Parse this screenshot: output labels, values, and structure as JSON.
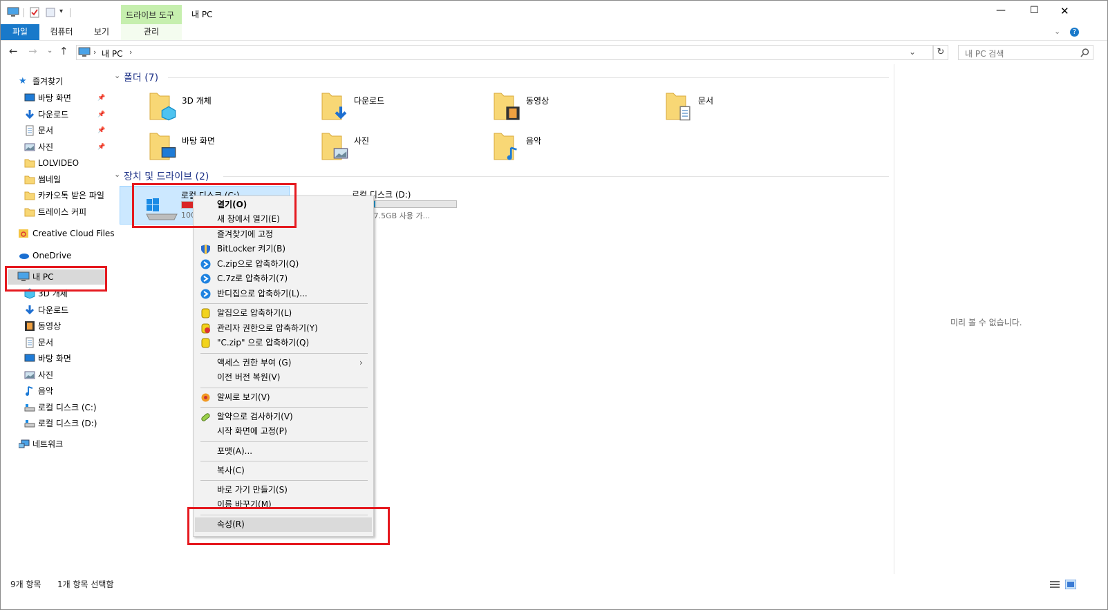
{
  "titlebar": {
    "title": "내 PC",
    "context_tab": "드라이브 도구",
    "minimize": "—",
    "maximize": "☐",
    "close": "✕"
  },
  "ribbon": {
    "tabs": [
      "파일",
      "컴퓨터",
      "보기",
      "관리"
    ]
  },
  "address": {
    "path_root": "내 PC",
    "sep": "›",
    "search_placeholder": "내 PC 검색"
  },
  "nav": {
    "quick_access": "즐겨찾기",
    "quick_items": [
      {
        "label": "바탕 화면",
        "icon": "desktop-icon"
      },
      {
        "label": "다운로드",
        "icon": "download-icon"
      },
      {
        "label": "문서",
        "icon": "document-icon"
      },
      {
        "label": "사진",
        "icon": "picture-icon"
      },
      {
        "label": "LOLVIDEO",
        "icon": "folder-icon"
      },
      {
        "label": "썸네일",
        "icon": "folder-icon"
      },
      {
        "label": "카카오톡 받은 파일",
        "icon": "folder-icon"
      },
      {
        "label": "트레이스 커피",
        "icon": "folder-icon"
      }
    ],
    "creative_cloud": "Creative Cloud Files",
    "onedrive": "OneDrive",
    "this_pc": "내 PC",
    "pc_items": [
      {
        "label": "3D 개체",
        "icon": "cube-icon"
      },
      {
        "label": "다운로드",
        "icon": "download-icon"
      },
      {
        "label": "동영상",
        "icon": "video-icon"
      },
      {
        "label": "문서",
        "icon": "document-icon"
      },
      {
        "label": "바탕 화면",
        "icon": "desktop-icon"
      },
      {
        "label": "사진",
        "icon": "picture-icon"
      },
      {
        "label": "음악",
        "icon": "music-icon"
      },
      {
        "label": "로컬 디스크 (C:)",
        "icon": "drive-icon"
      },
      {
        "label": "로컬 디스크 (D:)",
        "icon": "drive-icon"
      }
    ],
    "network": "네트워크"
  },
  "content": {
    "folders_header": "폴더 (7)",
    "folders": [
      "3D 개체",
      "다운로드",
      "동영상",
      "문서",
      "바탕 화면",
      "사진",
      "음악"
    ],
    "drives_header": "장치 및 드라이브 (2)",
    "drive_c": {
      "name": "로컬 디스크 (C:)",
      "free": "100",
      "used_fraction": 0.97,
      "bar_color": "#da2626"
    },
    "drive_d": {
      "name": "로컬 디스크 (D:)",
      "free": "B 중 57.5GB 사용 가...",
      "used_fraction": 0.22,
      "bar_color": "#26a0da"
    },
    "preview": "미리 볼 수 없습니다."
  },
  "context_menu": [
    {
      "label": "열기(O)",
      "bold": true
    },
    {
      "label": "새 창에서 열기(E)"
    },
    {
      "label": "즐겨찾기에 고정"
    },
    {
      "label": "BitLocker 켜기(B)",
      "icon": "shield-icon"
    },
    {
      "label": "C.zip으로 압축하기(Q)",
      "icon": "bandizip-icon"
    },
    {
      "label": "C.7z로 압축하기(7)",
      "icon": "bandizip-icon"
    },
    {
      "label": "반디집으로 압축하기(L)...",
      "icon": "bandizip-icon"
    },
    {
      "label": "알집으로 압축하기(L)",
      "icon": "alzip-icon"
    },
    {
      "label": "관리자 권한으로 압축하기(Y)",
      "icon": "alzip-admin-icon"
    },
    {
      "label": "\"C.zip\" 으로 압축하기(Q)",
      "icon": "alzip-icon"
    },
    {
      "label": "액세스 권한 부여 (G)",
      "submenu": true
    },
    {
      "label": "이전 버전 복원(V)"
    },
    {
      "label": "알씨로 보기(V)",
      "icon": "alsee-icon"
    },
    {
      "label": "알약으로 검사하기(V)",
      "icon": "alyac-icon"
    },
    {
      "label": "시작 화면에 고정(P)"
    },
    {
      "label": "포맷(A)..."
    },
    {
      "label": "복사(C)"
    },
    {
      "label": "바로 가기 만들기(S)"
    },
    {
      "label": "이름 바꾸기(M)"
    },
    {
      "label": "속성(R)",
      "highlighted": true
    }
  ],
  "status": {
    "items": "9개 항목",
    "selected": "1개 항목 선택함"
  },
  "colors": {
    "accent": "#1979ca",
    "highlight": "#e5191f",
    "drive_tools": "#c6efae"
  }
}
